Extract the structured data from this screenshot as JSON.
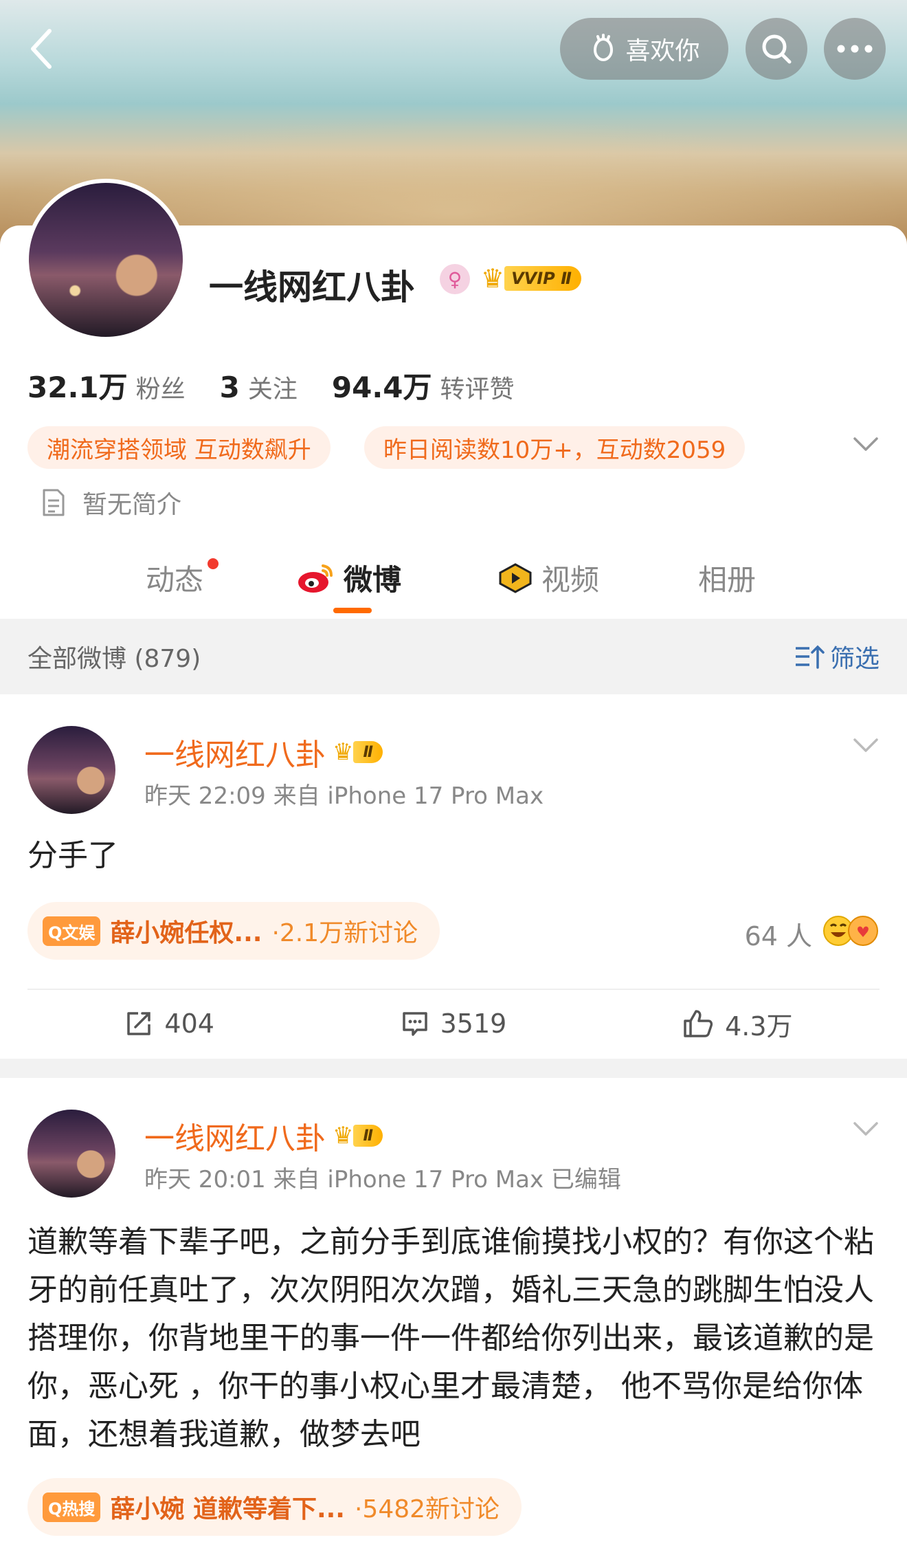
{
  "header": {
    "like_label": "喜欢你"
  },
  "profile": {
    "name": "一线网红八卦",
    "vip_label": "VVIP Ⅱ",
    "stats": [
      {
        "value": "32.1万",
        "label": "粉丝"
      },
      {
        "value": "3",
        "label": "关注"
      },
      {
        "value": "94.4万",
        "label": "转评赞"
      }
    ],
    "honors": [
      "潮流穿搭领域 互动数飙升",
      "昨日阅读数10万+，互动数2059"
    ],
    "bio": "暂无简介"
  },
  "tabs": [
    "动态",
    "微博",
    "视频",
    "相册"
  ],
  "filter": {
    "title": "全部微博 (879)",
    "button": "筛选"
  },
  "posts": [
    {
      "author": "一线网红八卦",
      "badge": "Ⅱ",
      "meta": "昨天 22:09  来自 iPhone 17 Pro Max",
      "text": "分手了",
      "topic_tag": "Q文娱",
      "topic_title": "薛小婉任权...",
      "topic_count": "·2.1万新讨论",
      "reactions": "64 人",
      "reposts": "404",
      "comments": "3519",
      "likes": "4.3万"
    },
    {
      "author": "一线网红八卦",
      "badge": "Ⅱ",
      "meta": "昨天 20:01  来自 iPhone 17 Pro Max  已编辑",
      "text": "道歉等着下辈子吧，之前分手到底谁偷摸找小权的？有你这个粘牙的前任真吐了，次次阴阳次次蹭，婚礼三天急的跳脚生怕没人搭理你，你背地里干的事一件一件都给你列出来，最该道歉的是你，恶心死 ，你干的事小权心里才最清楚， 他不骂你是给你体面，还想着我道歉，做梦去吧",
      "topic_tag": "Q热搜",
      "topic_title": "薛小婉 道歉等着下...",
      "topic_count": "·5482新讨论"
    }
  ]
}
